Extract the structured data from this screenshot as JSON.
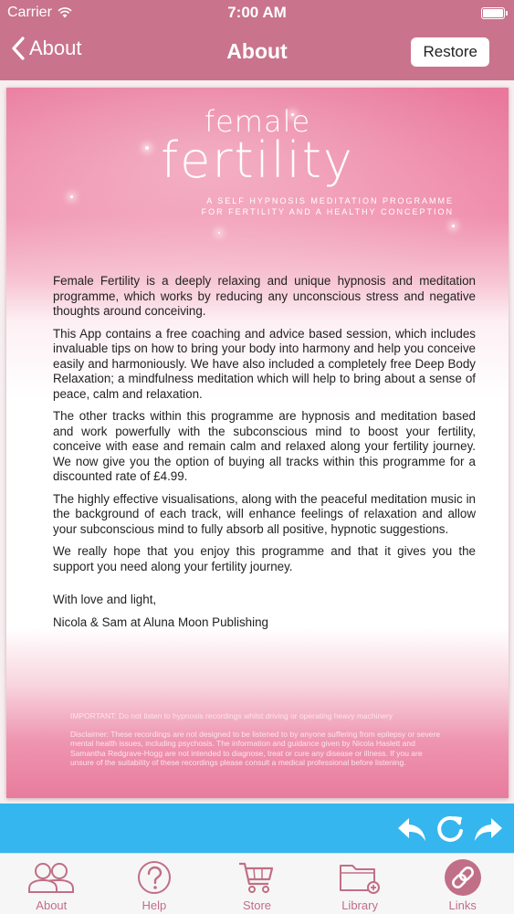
{
  "status_bar": {
    "carrier": "Carrier",
    "time": "7:00 AM"
  },
  "nav": {
    "back_label": "About",
    "title": "About",
    "restore_label": "Restore"
  },
  "card": {
    "title_small": "female",
    "title_large": "fertility",
    "subtitle_line1": "A SELF HYPNOSIS MEDITATION PROGRAMME",
    "subtitle_line2": "FOR FERTILITY AND A HEALTHY CONCEPTION",
    "paragraphs": [
      "Female Fertility is a deeply relaxing and unique hypnosis and meditation programme, which works by reducing any unconscious stress and negative thoughts around conceiving.",
      "This App contains a free coaching and advice based session, which includes invaluable tips on how to bring your body into harmony and help you conceive easily and harmoniously. We have also included a completely free Deep Body Relaxation; a mindfulness meditation which will help to bring about a sense of peace, calm and relaxation.",
      "The other tracks within this programme are hypnosis and meditation based and work powerfully with the subconscious mind to boost your fertility, conceive with ease and remain calm and relaxed along your fertility journey. We now give you the option of buying all tracks within this programme for a discounted rate of £4.99.",
      "The highly effective visualisations, along with the peaceful meditation music in the background of each track, will enhance feelings of relaxation and allow your subconscious mind to fully absorb all positive, hypnotic suggestions.",
      "We really hope that you enjoy this programme and that it gives you the support you need along your fertility journey."
    ],
    "signoff": "With love and light,",
    "signature": "Nicola & Sam at Aluna Moon Publishing",
    "important_note": "IMPORTANT: Do not listen to hypnosis recordings whilst driving or operating heavy machinery",
    "disclaimer": "Disclaimer: These recordings are not designed to be listened to by anyone suffering from epilepsy or severe mental health issues, including psychosis. The information and guidance given by Nicola Haslett and Samantha Redgrave-Hogg are not intended to diagnose, treat or cure any disease or illness. If you are unsure of the suitability of these recordings please consult a medical professional before listening."
  },
  "media_controls": [
    {
      "icon": "reply-back-icon"
    },
    {
      "icon": "refresh-icon"
    },
    {
      "icon": "forward-arrow-icon"
    }
  ],
  "tabs": [
    {
      "label": "About",
      "icon": "users-icon",
      "active": true
    },
    {
      "label": "Help",
      "icon": "question-circle-icon",
      "active": false
    },
    {
      "label": "Store",
      "icon": "cart-icon",
      "active": false
    },
    {
      "label": "Library",
      "icon": "folder-add-icon",
      "active": false
    },
    {
      "label": "Links",
      "icon": "link-icon",
      "active": false
    }
  ],
  "colors": {
    "header_pink": "#c9748c",
    "media_bar_blue": "#35b6ee",
    "tab_label_pink": "#c06f86"
  }
}
